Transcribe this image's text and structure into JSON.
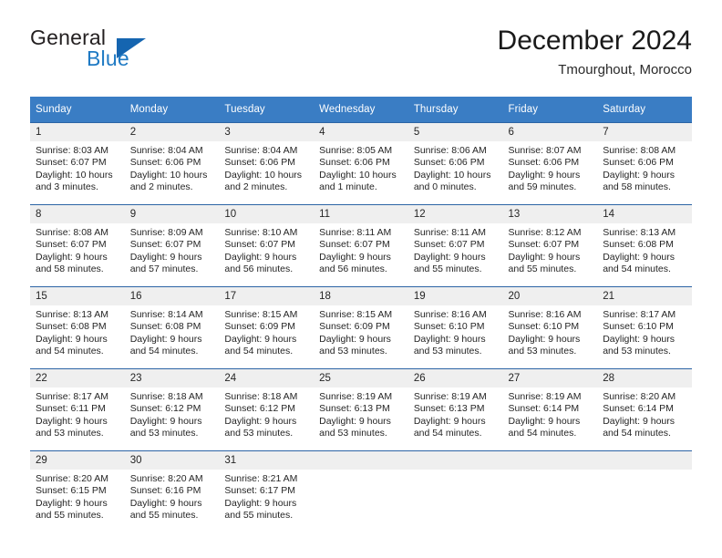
{
  "brand": {
    "name_top": "General",
    "name_bottom": "Blue",
    "triangle_color": "#1565b0",
    "blue_text_color": "#1f7ac4"
  },
  "header": {
    "title": "December 2024",
    "subtitle": "Tmourghout, Morocco"
  },
  "colors": {
    "header_row_bg": "#3a7dc4",
    "day_number_bg": "#efefef",
    "row_divider": "#2c64a5",
    "text": "#252525"
  },
  "weekday_headers": [
    "Sunday",
    "Monday",
    "Tuesday",
    "Wednesday",
    "Thursday",
    "Friday",
    "Saturday"
  ],
  "labels": {
    "sunrise_prefix": "Sunrise:",
    "sunset_prefix": "Sunset:",
    "daylight_prefix": "Daylight:"
  },
  "weeks": [
    [
      {
        "day": "1",
        "sunrise": "Sunrise: 8:03 AM",
        "sunset": "Sunset: 6:07 PM",
        "daylight": "Daylight: 10 hours and 3 minutes."
      },
      {
        "day": "2",
        "sunrise": "Sunrise: 8:04 AM",
        "sunset": "Sunset: 6:06 PM",
        "daylight": "Daylight: 10 hours and 2 minutes."
      },
      {
        "day": "3",
        "sunrise": "Sunrise: 8:04 AM",
        "sunset": "Sunset: 6:06 PM",
        "daylight": "Daylight: 10 hours and 2 minutes."
      },
      {
        "day": "4",
        "sunrise": "Sunrise: 8:05 AM",
        "sunset": "Sunset: 6:06 PM",
        "daylight": "Daylight: 10 hours and 1 minute."
      },
      {
        "day": "5",
        "sunrise": "Sunrise: 8:06 AM",
        "sunset": "Sunset: 6:06 PM",
        "daylight": "Daylight: 10 hours and 0 minutes."
      },
      {
        "day": "6",
        "sunrise": "Sunrise: 8:07 AM",
        "sunset": "Sunset: 6:06 PM",
        "daylight": "Daylight: 9 hours and 59 minutes."
      },
      {
        "day": "7",
        "sunrise": "Sunrise: 8:08 AM",
        "sunset": "Sunset: 6:06 PM",
        "daylight": "Daylight: 9 hours and 58 minutes."
      }
    ],
    [
      {
        "day": "8",
        "sunrise": "Sunrise: 8:08 AM",
        "sunset": "Sunset: 6:07 PM",
        "daylight": "Daylight: 9 hours and 58 minutes."
      },
      {
        "day": "9",
        "sunrise": "Sunrise: 8:09 AM",
        "sunset": "Sunset: 6:07 PM",
        "daylight": "Daylight: 9 hours and 57 minutes."
      },
      {
        "day": "10",
        "sunrise": "Sunrise: 8:10 AM",
        "sunset": "Sunset: 6:07 PM",
        "daylight": "Daylight: 9 hours and 56 minutes."
      },
      {
        "day": "11",
        "sunrise": "Sunrise: 8:11 AM",
        "sunset": "Sunset: 6:07 PM",
        "daylight": "Daylight: 9 hours and 56 minutes."
      },
      {
        "day": "12",
        "sunrise": "Sunrise: 8:11 AM",
        "sunset": "Sunset: 6:07 PM",
        "daylight": "Daylight: 9 hours and 55 minutes."
      },
      {
        "day": "13",
        "sunrise": "Sunrise: 8:12 AM",
        "sunset": "Sunset: 6:07 PM",
        "daylight": "Daylight: 9 hours and 55 minutes."
      },
      {
        "day": "14",
        "sunrise": "Sunrise: 8:13 AM",
        "sunset": "Sunset: 6:08 PM",
        "daylight": "Daylight: 9 hours and 54 minutes."
      }
    ],
    [
      {
        "day": "15",
        "sunrise": "Sunrise: 8:13 AM",
        "sunset": "Sunset: 6:08 PM",
        "daylight": "Daylight: 9 hours and 54 minutes."
      },
      {
        "day": "16",
        "sunrise": "Sunrise: 8:14 AM",
        "sunset": "Sunset: 6:08 PM",
        "daylight": "Daylight: 9 hours and 54 minutes."
      },
      {
        "day": "17",
        "sunrise": "Sunrise: 8:15 AM",
        "sunset": "Sunset: 6:09 PM",
        "daylight": "Daylight: 9 hours and 54 minutes."
      },
      {
        "day": "18",
        "sunrise": "Sunrise: 8:15 AM",
        "sunset": "Sunset: 6:09 PM",
        "daylight": "Daylight: 9 hours and 53 minutes."
      },
      {
        "day": "19",
        "sunrise": "Sunrise: 8:16 AM",
        "sunset": "Sunset: 6:10 PM",
        "daylight": "Daylight: 9 hours and 53 minutes."
      },
      {
        "day": "20",
        "sunrise": "Sunrise: 8:16 AM",
        "sunset": "Sunset: 6:10 PM",
        "daylight": "Daylight: 9 hours and 53 minutes."
      },
      {
        "day": "21",
        "sunrise": "Sunrise: 8:17 AM",
        "sunset": "Sunset: 6:10 PM",
        "daylight": "Daylight: 9 hours and 53 minutes."
      }
    ],
    [
      {
        "day": "22",
        "sunrise": "Sunrise: 8:17 AM",
        "sunset": "Sunset: 6:11 PM",
        "daylight": "Daylight: 9 hours and 53 minutes."
      },
      {
        "day": "23",
        "sunrise": "Sunrise: 8:18 AM",
        "sunset": "Sunset: 6:12 PM",
        "daylight": "Daylight: 9 hours and 53 minutes."
      },
      {
        "day": "24",
        "sunrise": "Sunrise: 8:18 AM",
        "sunset": "Sunset: 6:12 PM",
        "daylight": "Daylight: 9 hours and 53 minutes."
      },
      {
        "day": "25",
        "sunrise": "Sunrise: 8:19 AM",
        "sunset": "Sunset: 6:13 PM",
        "daylight": "Daylight: 9 hours and 53 minutes."
      },
      {
        "day": "26",
        "sunrise": "Sunrise: 8:19 AM",
        "sunset": "Sunset: 6:13 PM",
        "daylight": "Daylight: 9 hours and 54 minutes."
      },
      {
        "day": "27",
        "sunrise": "Sunrise: 8:19 AM",
        "sunset": "Sunset: 6:14 PM",
        "daylight": "Daylight: 9 hours and 54 minutes."
      },
      {
        "day": "28",
        "sunrise": "Sunrise: 8:20 AM",
        "sunset": "Sunset: 6:14 PM",
        "daylight": "Daylight: 9 hours and 54 minutes."
      }
    ],
    [
      {
        "day": "29",
        "sunrise": "Sunrise: 8:20 AM",
        "sunset": "Sunset: 6:15 PM",
        "daylight": "Daylight: 9 hours and 55 minutes."
      },
      {
        "day": "30",
        "sunrise": "Sunrise: 8:20 AM",
        "sunset": "Sunset: 6:16 PM",
        "daylight": "Daylight: 9 hours and 55 minutes."
      },
      {
        "day": "31",
        "sunrise": "Sunrise: 8:21 AM",
        "sunset": "Sunset: 6:17 PM",
        "daylight": "Daylight: 9 hours and 55 minutes."
      },
      {
        "day": "",
        "sunrise": "",
        "sunset": "",
        "daylight": ""
      },
      {
        "day": "",
        "sunrise": "",
        "sunset": "",
        "daylight": ""
      },
      {
        "day": "",
        "sunrise": "",
        "sunset": "",
        "daylight": ""
      },
      {
        "day": "",
        "sunrise": "",
        "sunset": "",
        "daylight": ""
      }
    ]
  ]
}
